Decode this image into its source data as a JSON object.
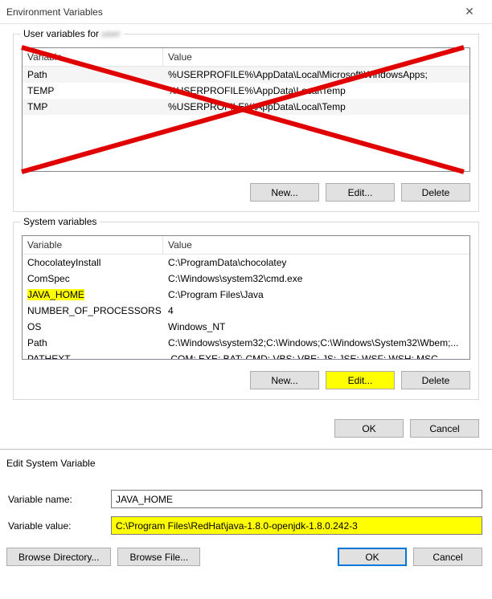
{
  "titlebar": {
    "title": "Environment Variables"
  },
  "user_section": {
    "legend_prefix": "User variables for ",
    "legend_user": "user",
    "headers": {
      "variable": "Variable",
      "value": "Value"
    },
    "rows": [
      {
        "variable": "Path",
        "value": "%USERPROFILE%\\AppData\\Local\\Microsoft\\WindowsApps;"
      },
      {
        "variable": "TEMP",
        "value": "%USERPROFILE%\\AppData\\Local\\Temp"
      },
      {
        "variable": "TMP",
        "value": "%USERPROFILE%\\AppData\\Local\\Temp"
      }
    ],
    "buttons": {
      "new": "New...",
      "edit": "Edit...",
      "delete": "Delete"
    }
  },
  "system_section": {
    "legend": "System variables",
    "headers": {
      "variable": "Variable",
      "value": "Value"
    },
    "rows": [
      {
        "variable": "ChocolateyInstall",
        "value": "C:\\ProgramData\\chocolatey",
        "hl": false
      },
      {
        "variable": "ComSpec",
        "value": "C:\\Windows\\system32\\cmd.exe",
        "hl": false
      },
      {
        "variable": "JAVA_HOME",
        "value": "C:\\Program Files\\Java",
        "hl": true
      },
      {
        "variable": "NUMBER_OF_PROCESSORS",
        "value": "4",
        "hl": false
      },
      {
        "variable": "OS",
        "value": "Windows_NT",
        "hl": false
      },
      {
        "variable": "Path",
        "value": "C:\\Windows\\system32;C:\\Windows;C:\\Windows\\System32\\Wbem;...",
        "hl": false
      },
      {
        "variable": "PATHEXT",
        "value": ".COM;.EXE;.BAT;.CMD;.VBS;.VBE;.JS;.JSE;.WSF;.WSH;.MSC",
        "hl": false
      }
    ],
    "buttons": {
      "new": "New...",
      "edit": "Edit...",
      "delete": "Delete"
    }
  },
  "main_buttons": {
    "ok": "OK",
    "cancel": "Cancel"
  },
  "edit_dialog": {
    "title": "Edit System Variable",
    "name_label": "Variable name:",
    "name_value": "JAVA_HOME",
    "value_label": "Variable value:",
    "value_value": "C:\\Program Files\\RedHat\\java-1.8.0-openjdk-1.8.0.242-3",
    "browse_dir": "Browse Directory...",
    "browse_file": "Browse File...",
    "ok": "OK",
    "cancel": "Cancel"
  }
}
